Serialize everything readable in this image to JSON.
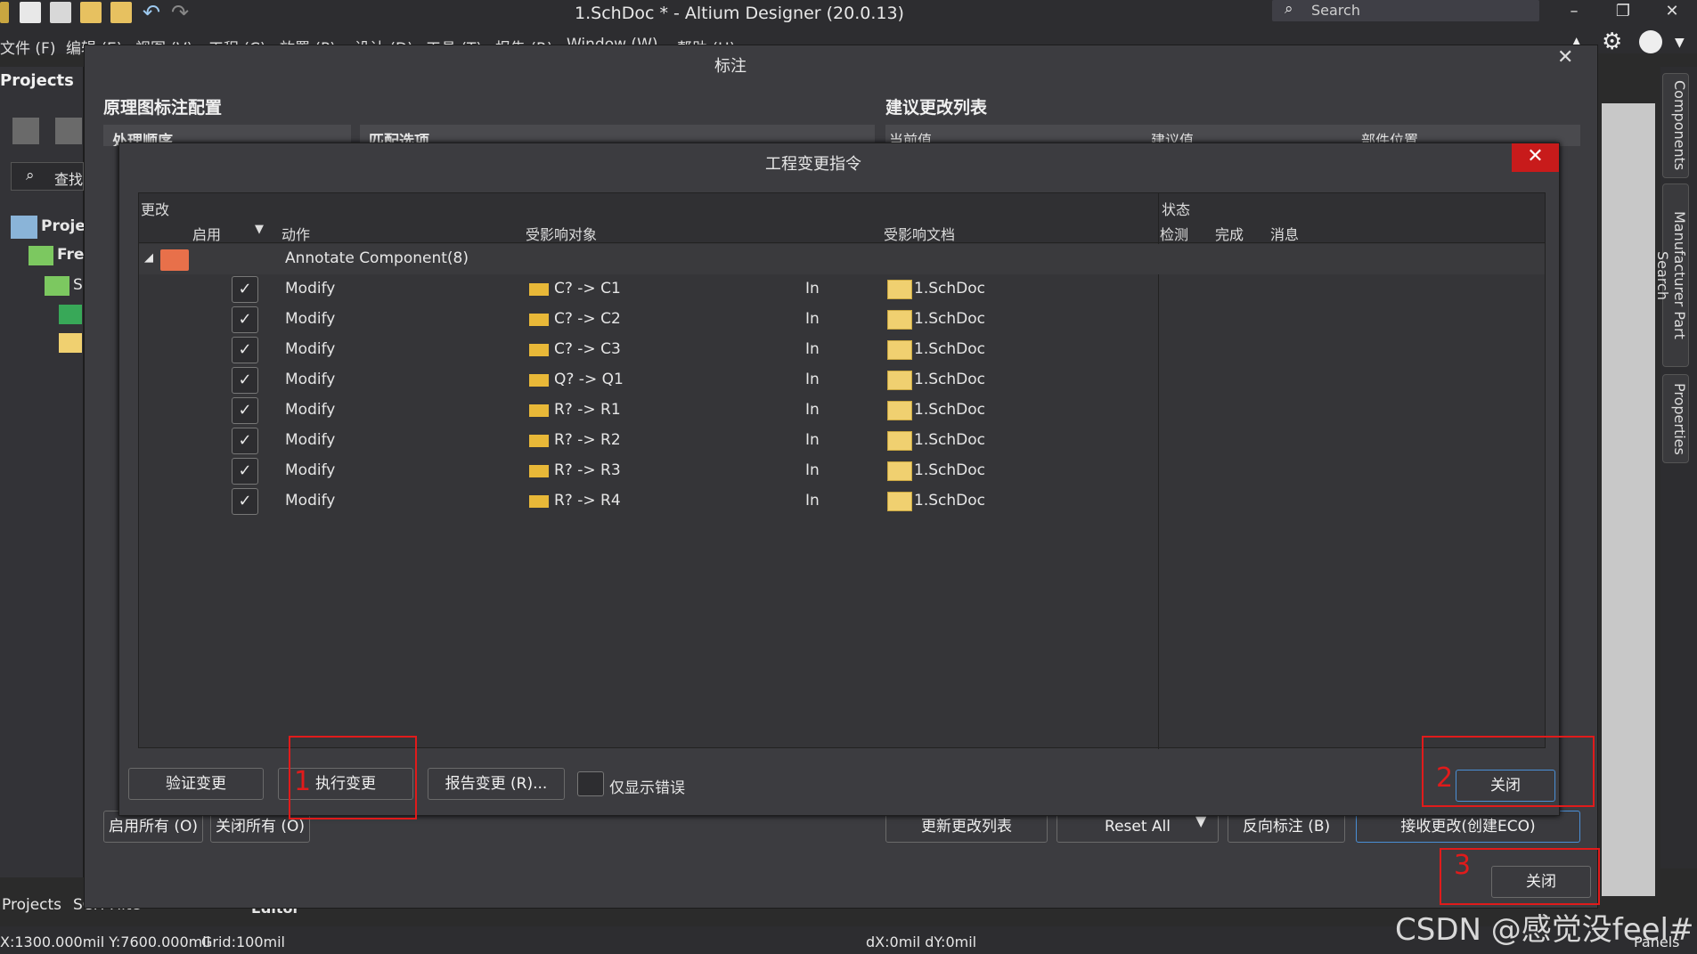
{
  "app": {
    "title": "1.SchDoc * - Altium Designer (20.0.13)",
    "search_placeholder": "Search"
  },
  "menu": [
    "文件 (F)",
    "编辑 (E)",
    "视图 (V)",
    "工程 (C)",
    "放置 (P)",
    "设计 (D)",
    "工具 (T)",
    "报告 (R)",
    "Window (W)",
    "帮助 (H)"
  ],
  "left_panel": {
    "header": "Projects",
    "search": "查找",
    "tree": [
      "Projec",
      "Free",
      "S"
    ],
    "bottom_tabs": [
      "Projects",
      "SCH Filter"
    ]
  },
  "right_tabs": [
    "Components",
    "Manufacturer Part Search",
    "Properties"
  ],
  "editor_tab": "Editor",
  "annotate_dialog": {
    "title": "标注",
    "left_section": "原理图标注配置",
    "left_cols": [
      "处理顺序",
      "匹配选项"
    ],
    "right_section": "建议更改列表",
    "right_cols": [
      "当前值",
      "建议值",
      "部件位置"
    ],
    "buttons": {
      "enable_all": "启用所有 (O)",
      "disable_all": "关闭所有 (O)",
      "update_list": "更新更改列表",
      "reset_all": "Reset All",
      "back_annotate": "反向标注 (B)",
      "accept_changes": "接收更改(创建ECO)",
      "close": "关闭"
    }
  },
  "eco_dialog": {
    "title": "工程变更指令",
    "col_group_changes": "更改",
    "col_group_status": "状态",
    "columns": {
      "enable": "启用",
      "action": "动作",
      "affected_object": "受影响对象",
      "affected_doc": "受影响文档",
      "check": "检测",
      "done": "完成",
      "message": "消息"
    },
    "group_label": "Annotate Component(8)",
    "rows": [
      {
        "checked": true,
        "action": "Modify",
        "object": "C? -> C1",
        "in": "In",
        "doc": "1.SchDoc"
      },
      {
        "checked": true,
        "action": "Modify",
        "object": "C? -> C2",
        "in": "In",
        "doc": "1.SchDoc"
      },
      {
        "checked": true,
        "action": "Modify",
        "object": "C? -> C3",
        "in": "In",
        "doc": "1.SchDoc"
      },
      {
        "checked": true,
        "action": "Modify",
        "object": "Q? -> Q1",
        "in": "In",
        "doc": "1.SchDoc"
      },
      {
        "checked": true,
        "action": "Modify",
        "object": "R? -> R1",
        "in": "In",
        "doc": "1.SchDoc"
      },
      {
        "checked": true,
        "action": "Modify",
        "object": "R? -> R2",
        "in": "In",
        "doc": "1.SchDoc"
      },
      {
        "checked": true,
        "action": "Modify",
        "object": "R? -> R3",
        "in": "In",
        "doc": "1.SchDoc"
      },
      {
        "checked": true,
        "action": "Modify",
        "object": "R? -> R4",
        "in": "In",
        "doc": "1.SchDoc"
      }
    ],
    "buttons": {
      "validate": "验证变更",
      "execute": "执行变更",
      "report": "报告变更 (R)...",
      "only_errors": "仅显示错误",
      "close": "关闭"
    }
  },
  "annotations": [
    "1",
    "2",
    "3"
  ],
  "status_bar": {
    "coords": "X:1300.000mil Y:7600.000mil",
    "grid": "Grid:100mil",
    "delta": "dX:0mil dY:0mil",
    "panels": "Panels"
  },
  "watermark": "CSDN @感觉没feel#",
  "colors": {
    "close_red": "#c81b1b",
    "annotation_red": "#e01b1b",
    "accent_blue": "#4a8fd6"
  }
}
